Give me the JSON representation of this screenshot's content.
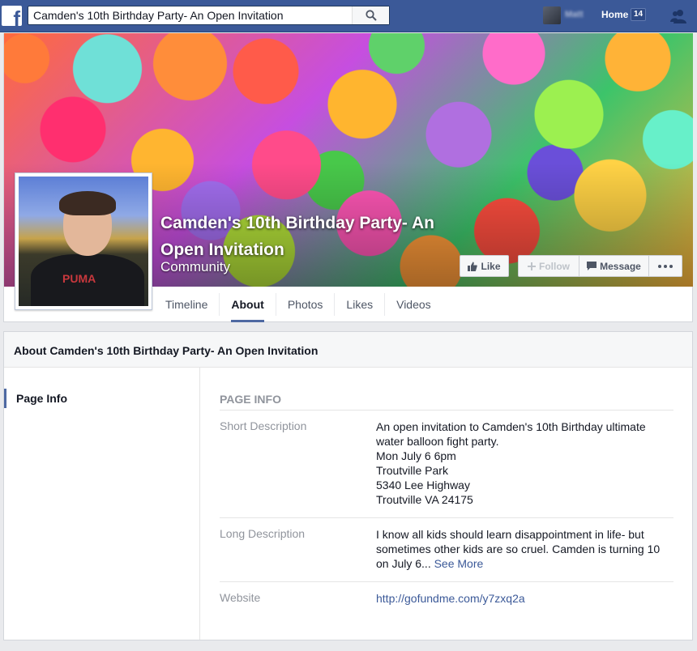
{
  "topbar": {
    "search_value": "Camden's 10th Birthday Party- An Open Invitation",
    "user_name": "Matt",
    "home_label": "Home",
    "home_count": "14"
  },
  "cover": {
    "page_title": "Camden's 10th Birthday Party- An Open Invitation",
    "category": "Community",
    "buttons": {
      "like": "Like",
      "follow": "Follow",
      "message": "Message"
    },
    "profile_shirt_text": "PUMA"
  },
  "tabs": [
    "Timeline",
    "About",
    "Photos",
    "Likes",
    "Videos"
  ],
  "about": {
    "header": "About Camden's 10th Birthday Party- An Open Invitation",
    "nav": [
      "Page Info"
    ],
    "section_title": "PAGE INFO",
    "short_description": {
      "label": "Short Description",
      "lines": [
        "An open invitation to Camden's 10th Birthday ultimate water balloon fight party.",
        "Mon July 6 6pm",
        "Troutville Park",
        "5340 Lee Highway",
        "Troutville VA 24175"
      ]
    },
    "long_description": {
      "label": "Long Description",
      "text": "I know all kids should learn disappointment in life- but sometimes other kids are so cruel. Camden is turning 10 on July 6...",
      "see_more": "See More"
    },
    "website": {
      "label": "Website",
      "url": "http://gofundme.com/y7zxq2a"
    }
  },
  "colors": {
    "brand": "#3b5998",
    "link": "#3b5998",
    "muted": "#90949c",
    "tab_active": "#4e69a2"
  }
}
